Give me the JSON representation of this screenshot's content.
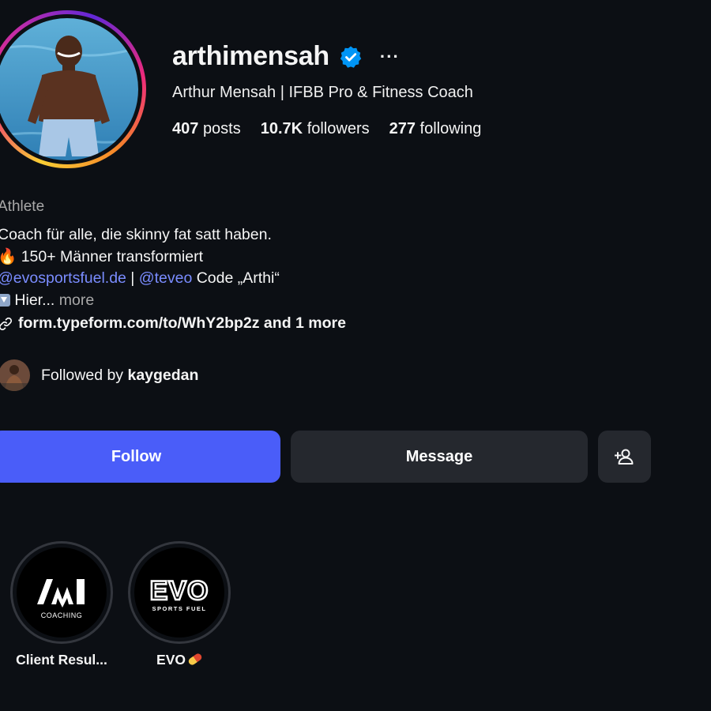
{
  "profile": {
    "username": "arthimensah",
    "more_label": "···",
    "full_name": "Arthur Mensah | IFBB Pro & Fitness Coach",
    "stats": {
      "posts_count": "407",
      "posts_label": "posts",
      "followers_count": "10.7K",
      "followers_label": "followers",
      "following_count": "277",
      "following_label": "following"
    },
    "category": "Athlete",
    "bio": {
      "line1": "Coach für alle, die skinny fat satt haben.",
      "line2_emoji": "🔥",
      "line2_text": "150+ Männer transformiert",
      "line3_mention1": "@evosportsfuel.de",
      "line3_sep": " | ",
      "line3_mention2": "@teveo",
      "line3_text": " Code „Arthi“",
      "line4_text": "Hier...",
      "line4_more": "more"
    },
    "link": "form.typeform.com/to/WhY2bp2z and 1 more",
    "followed_by_prefix": "Followed by ",
    "followed_by_user": "kaygedan"
  },
  "actions": {
    "follow": "Follow",
    "message": "Message",
    "add_user_icon": "person-add-icon"
  },
  "highlights": [
    {
      "title": "Client Resul...",
      "logo_text": "COACHING"
    },
    {
      "title": "EVO",
      "logo_text": "EVO",
      "logo_subtext": "SPORTS FUEL"
    }
  ],
  "colors": {
    "background": "#0c0f14",
    "follow_button": "#4a5df9",
    "secondary_button": "#25282e",
    "mention": "#7a8cff",
    "verified_badge": "#0095f6",
    "muted_text": "#a8a8a8"
  }
}
